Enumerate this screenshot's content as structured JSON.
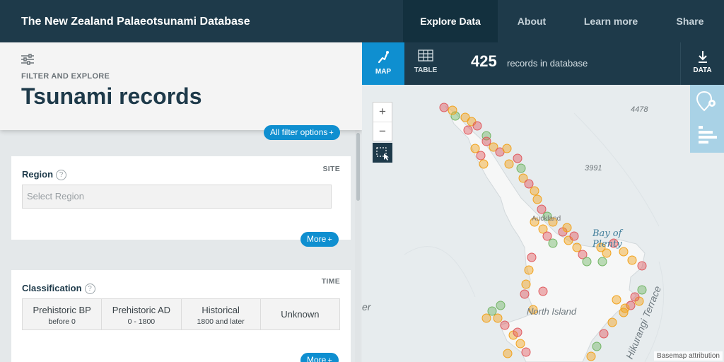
{
  "header": {
    "title": "The New Zealand Palaeotsunami Database",
    "nav": [
      "Explore Data",
      "About",
      "Learn more",
      "Share"
    ]
  },
  "left_panel": {
    "eyebrow": "FILTER AND EXPLORE",
    "title": "Tsunami records",
    "all_filters_label": "All filter options",
    "region": {
      "label": "Region",
      "help": "?",
      "tag": "SITE",
      "placeholder": "Select Region",
      "more_label": "More"
    },
    "classification": {
      "label": "Classification",
      "help": "?",
      "tag": "TIME",
      "options": [
        {
          "label": "Prehistoric BP",
          "sub": "before 0"
        },
        {
          "label": "Prehistoric AD",
          "sub": "0 - 1800"
        },
        {
          "label": "Historical",
          "sub": "1800 and later"
        },
        {
          "label": "Unknown",
          "sub": ""
        }
      ],
      "more_label": "More"
    }
  },
  "map_bar": {
    "map_label": "MAP",
    "table_label": "TABLE",
    "record_count": "425",
    "record_text": "records in database",
    "data_label": "DATA"
  },
  "map": {
    "labels": {
      "depth_4478": "4478",
      "depth_3991": "3991",
      "auckland": "Auckland",
      "bay": "Bay of",
      "bay2": "Plenty",
      "island": "North Island",
      "ridge": "Hikurangi Terrace",
      "edge": "er"
    },
    "zoom_in": "+",
    "zoom_out": "−",
    "attribution": "Basemap attribution",
    "marker_colors": {
      "red": "#e0595d",
      "orange": "#f2a21b",
      "green": "#72b564"
    }
  }
}
